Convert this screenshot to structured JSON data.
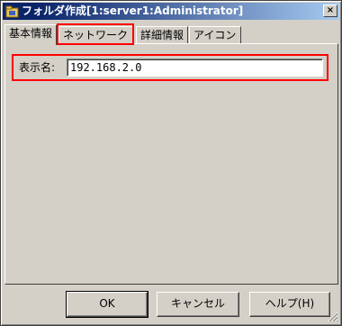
{
  "window": {
    "title": "フォルダ作成[1:server1:Administrator]",
    "close_glyph": "×",
    "icon": "folder-app-icon"
  },
  "tabs": [
    {
      "label": "基本情報",
      "active": true
    },
    {
      "label": "ネットワーク",
      "active": false
    },
    {
      "label": "詳細情報",
      "active": false
    },
    {
      "label": "アイコン",
      "active": false
    }
  ],
  "form": {
    "display_name_label": "表示名:",
    "display_name_value": "192.168.2.0"
  },
  "buttons": {
    "ok": "OK",
    "cancel": "キャンセル",
    "help": "ヘルプ(H)"
  },
  "colors": {
    "highlight": "#ff0000",
    "titlebar": "#0a246a",
    "face": "#d4d0c8"
  }
}
